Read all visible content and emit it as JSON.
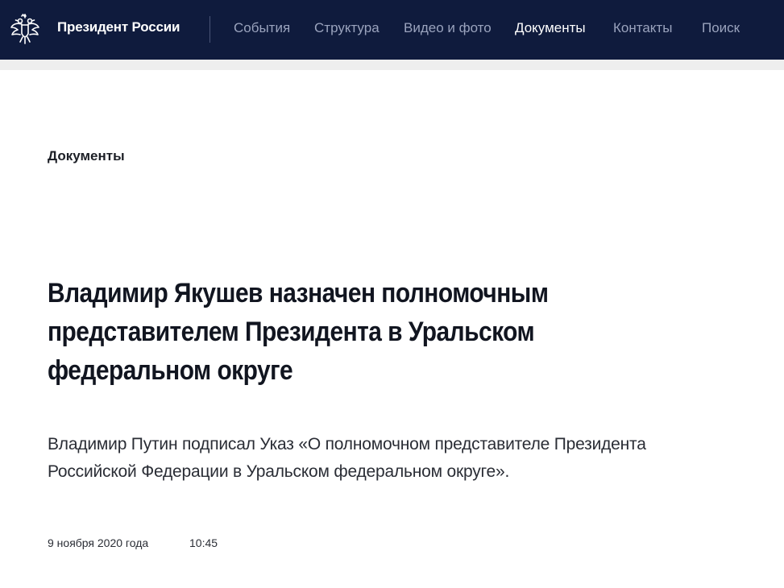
{
  "header": {
    "brand": "Президент России",
    "emblem_icon": "double-headed-eagle-icon",
    "nav": [
      {
        "label": "События"
      },
      {
        "label": "Структура"
      },
      {
        "label": "Видео и фото"
      },
      {
        "label": "Документы"
      },
      {
        "label": "Контакты"
      },
      {
        "label": "Поиск"
      }
    ],
    "active_nav": "Документы"
  },
  "article": {
    "section": "Документы",
    "title": "Владимир Якушев назначен полномочным представителем Президента в Уральском федеральном округе",
    "lead": "Владимир Путин подписал Указ «О полномочном представителе Президента Российской Федерации в Уральском федеральном округе».",
    "date": "9 ноября 2020 года",
    "time": "10:45"
  },
  "colors": {
    "navbar_bg": "#0f1b3d",
    "nav_inactive": "#9aa3bd",
    "nav_active": "#ffffff",
    "subbar": "#eeeeee",
    "text": "#111520"
  }
}
